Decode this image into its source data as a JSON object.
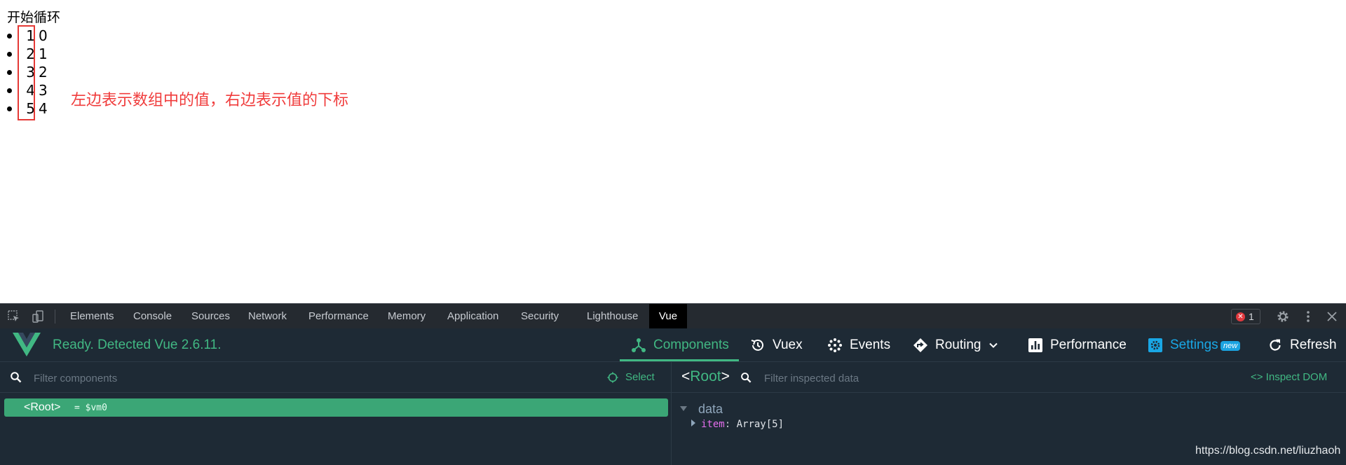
{
  "page": {
    "title": "开始循环",
    "rows": [
      {
        "value": "1",
        "index": "0"
      },
      {
        "value": "2",
        "index": "1"
      },
      {
        "value": "3",
        "index": "2"
      },
      {
        "value": "4",
        "index": "3"
      },
      {
        "value": "5",
        "index": "4"
      }
    ],
    "annotation": "左边表示数组中的值，右边表示值的下标",
    "annotation_color": "#f03c3c",
    "highlight_color": "#e53935"
  },
  "devtools": {
    "tabs": [
      "Elements",
      "Console",
      "Sources",
      "Network",
      "Performance",
      "Memory",
      "Application",
      "Security",
      "Lighthouse",
      "Vue"
    ],
    "active_tab": "Vue",
    "error_count": "1",
    "error_icon": "✕"
  },
  "vue": {
    "status": "Ready. Detected Vue 2.6.11.",
    "nav": {
      "components": "Components",
      "vuex": "Vuex",
      "events": "Events",
      "routing": "Routing",
      "performance": "Performance",
      "settings": "Settings",
      "settings_badge": "new",
      "refresh": "Refresh"
    },
    "accent_color": "#41b883",
    "settings_color": "#19a7e5"
  },
  "components_panel": {
    "filter_placeholder": "Filter components",
    "select_label": "Select",
    "root": {
      "tag": "<Root>",
      "vm": "= $vm0"
    }
  },
  "inspector": {
    "title_open": "<",
    "title_name": "Root",
    "title_close": ">",
    "filter_placeholder": "Filter inspected data",
    "inspect_dom": "<> Inspect DOM",
    "section": "data",
    "item": {
      "key": "item",
      "colon": ":",
      "value": "Array[5]"
    }
  },
  "watermark": "https://blog.csdn.net/liuzhaoh"
}
